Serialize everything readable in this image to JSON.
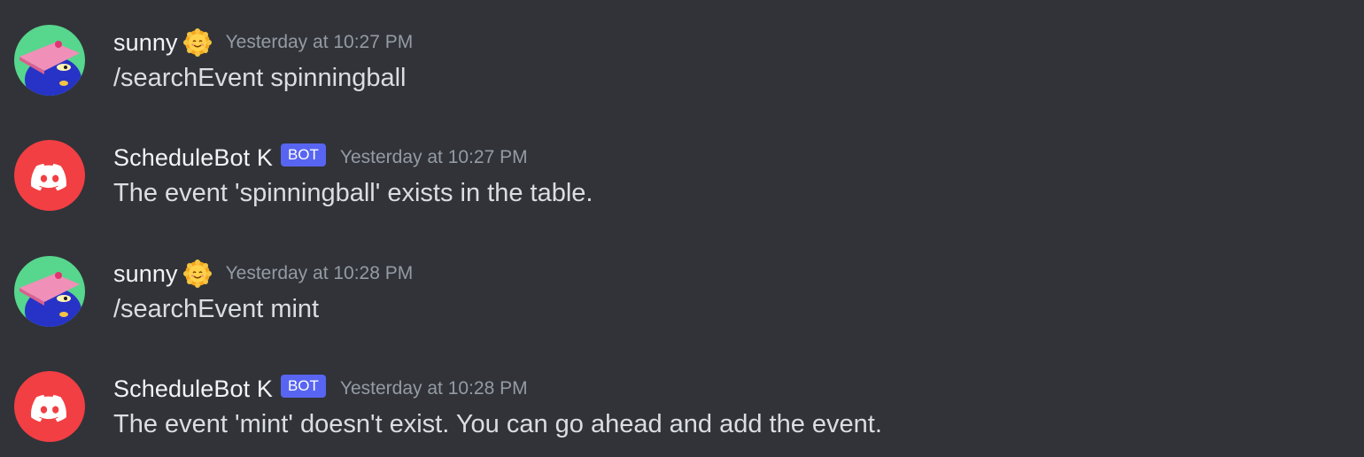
{
  "colors": {
    "background": "#313338",
    "username": "#f2f3f5",
    "message_text": "#dbdee1",
    "timestamp": "#949ba4",
    "bot_tag": "#5865f2",
    "discord_avatar": "#f23f43",
    "sunny_avatar_bg": "#57d68d"
  },
  "messages": [
    {
      "author": "sunny",
      "avatar_icon": "sunny-avatar-icon",
      "status_emoji": "sun-face-emoji-icon",
      "timestamp": "Yesterday at 10:27 PM",
      "text": "/searchEvent spinningball"
    },
    {
      "author": "ScheduleBot K",
      "avatar_icon": "discord-logo-icon",
      "tag": "BOT",
      "timestamp": "Yesterday at 10:27 PM",
      "text": "The event 'spinningball' exists in the table."
    },
    {
      "author": "sunny",
      "avatar_icon": "sunny-avatar-icon",
      "status_emoji": "sun-face-emoji-icon",
      "timestamp": "Yesterday at 10:28 PM",
      "text": "/searchEvent mint"
    },
    {
      "author": "ScheduleBot K",
      "avatar_icon": "discord-logo-icon",
      "tag": "BOT",
      "timestamp": "Yesterday at 10:28 PM",
      "text": "The event 'mint' doesn't exist. You can go ahead and add the event."
    }
  ]
}
